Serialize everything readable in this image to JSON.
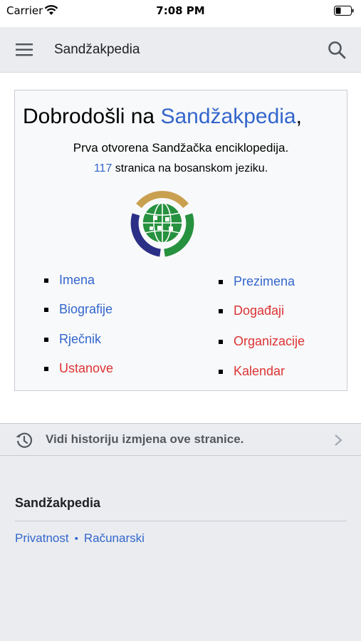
{
  "status_bar": {
    "carrier": "Carrier",
    "time": "7:08 PM"
  },
  "header": {
    "title": "Sandžakpedia",
    "menu_icon": "hamburger-menu-icon",
    "search_icon": "search-icon"
  },
  "welcome": {
    "prefix": "Dobrodošli na ",
    "site_link": "Sandžakpedia",
    "suffix": ",",
    "tagline": "Prva otvorena Sandžačka enciklopedija.",
    "count": "117",
    "count_suffix": " stranica na bosanskom jeziku.",
    "logo_icon": "globe-logo-icon"
  },
  "links_left": [
    {
      "label": "Imena",
      "color": "#3366cc"
    },
    {
      "label": "Biografije",
      "color": "#3366cc"
    },
    {
      "label": "Rječnik",
      "color": "#3366cc"
    },
    {
      "label": "Ustanove",
      "color": "#dd3333"
    }
  ],
  "links_right": [
    {
      "label": "Prezimena",
      "color": "#3366cc"
    },
    {
      "label": "Događaji",
      "color": "#dd3333"
    },
    {
      "label": "Organizacije",
      "color": "#dd3333"
    },
    {
      "label": "Kalendar",
      "color": "#dd3333"
    }
  ],
  "history": {
    "label": "Vidi historiju izmjena ove stranice.",
    "icon": "history-icon"
  },
  "footer": {
    "title": "Sandžakpedia",
    "links": [
      "Privatnost",
      "Računarski"
    ],
    "separator": "•"
  },
  "colors": {
    "link": "#3366cc",
    "new_link": "#dd3333",
    "chrome": "#eaecf0"
  }
}
